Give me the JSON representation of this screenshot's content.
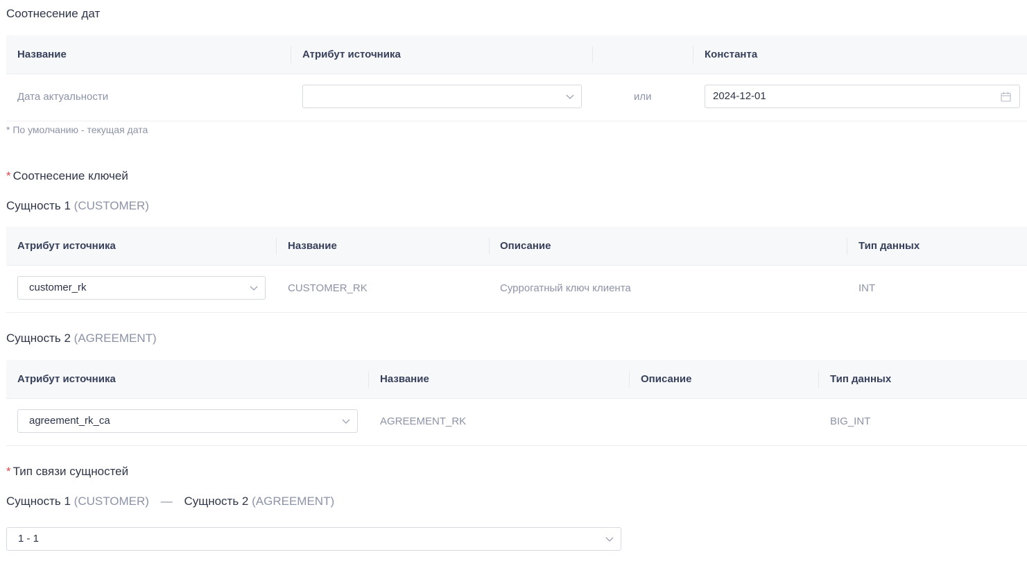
{
  "date_section": {
    "title": "Соотнесение дат",
    "headers": [
      "Название",
      "Атрибут источника",
      "Константа"
    ],
    "row": {
      "name": "Дата актуальности",
      "source_value": "",
      "or": "или",
      "constant_value": "2024-12-01"
    },
    "hint": "* По умолчанию - текущая дата"
  },
  "keys_section": {
    "required_mark": "*",
    "title": "Соотнесение ключей",
    "entity1": {
      "label": "Сущность 1",
      "code": "(CUSTOMER)",
      "headers": [
        "Атрибут источника",
        "Название",
        "Описание",
        "Тип данных"
      ],
      "row": {
        "source": "customer_rk",
        "name": "CUSTOMER_RK",
        "description": "Суррогатный ключ клиента",
        "type": "INT"
      }
    },
    "entity2": {
      "label": "Сущность 2",
      "code": "(AGREEMENT)",
      "headers": [
        "Атрибут источника",
        "Название",
        "Описание",
        "Тип данных"
      ],
      "row": {
        "source": "agreement_rk_ca",
        "name": "AGREEMENT_RK",
        "description": "",
        "type": "BIG_INT"
      }
    }
  },
  "relation_section": {
    "required_mark": "*",
    "title": "Тип связи сущностей",
    "entity1_label": "Сущность 1",
    "entity1_code": "(CUSTOMER)",
    "dash": "—",
    "entity2_label": "Сущность 2",
    "entity2_code": "(AGREEMENT)",
    "value": "1 - 1"
  },
  "icons": {
    "chevron": "chevron-down-icon",
    "calendar": "calendar-icon"
  },
  "colors": {
    "required": "#e0474a",
    "muted": "#8c93a6",
    "header_bg": "#f7f8fa",
    "border": "#d5d9e0"
  }
}
